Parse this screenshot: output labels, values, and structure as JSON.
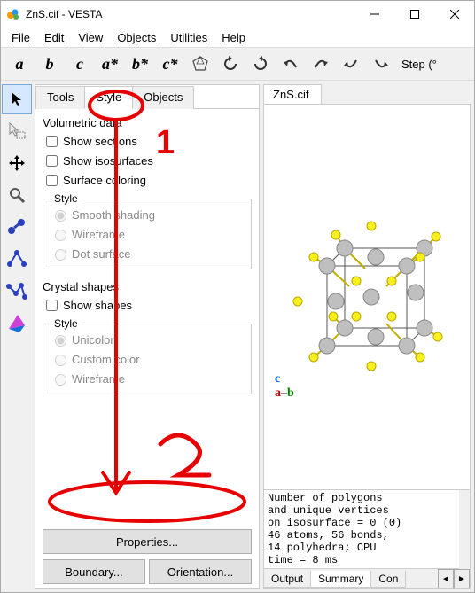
{
  "window": {
    "title": "ZnS.cif - VESTA"
  },
  "menu": {
    "file": "File",
    "edit": "Edit",
    "view": "View",
    "objects": "Objects",
    "utilities": "Utilities",
    "help": "Help"
  },
  "toolbar": {
    "a": "a",
    "b": "b",
    "c": "c",
    "astar": "a*",
    "bstar": "b*",
    "cstar": "c*",
    "step_label": "Step (°"
  },
  "left_tabs": {
    "tools": "Tools",
    "style": "Style",
    "objects": "Objects"
  },
  "style": {
    "volumetric_title": "Volumetric data",
    "show_sections": "Show sections",
    "show_isosurfaces": "Show isosurfaces",
    "surface_coloring": "Surface coloring",
    "style_legend": "Style",
    "smooth_shading": "Smooth shading",
    "wireframe": "Wireframe",
    "dot_surface": "Dot surface",
    "crystal_shapes_title": "Crystal shapes",
    "show_shapes": "Show shapes",
    "unicolor": "Unicolor",
    "custom_color": "Custom color",
    "cs_wireframe": "Wireframe",
    "properties_btn": "Properties...",
    "boundary_btn": "Boundary...",
    "orientation_btn": "Orientation..."
  },
  "file_tab": "ZnS.cif",
  "axes": {
    "c": "c",
    "a": "a",
    "dash": "–",
    "b": "b"
  },
  "log": {
    "text": "Number of polygons\nand unique vertices\non isosurface = 0 (0)\n46 atoms, 56 bonds,\n14 polyhedra; CPU\ntime = 8 ms",
    "output": "Output",
    "summary": "Summary",
    "comment": "Con"
  },
  "annot": {
    "one": "1",
    "two": "2"
  }
}
